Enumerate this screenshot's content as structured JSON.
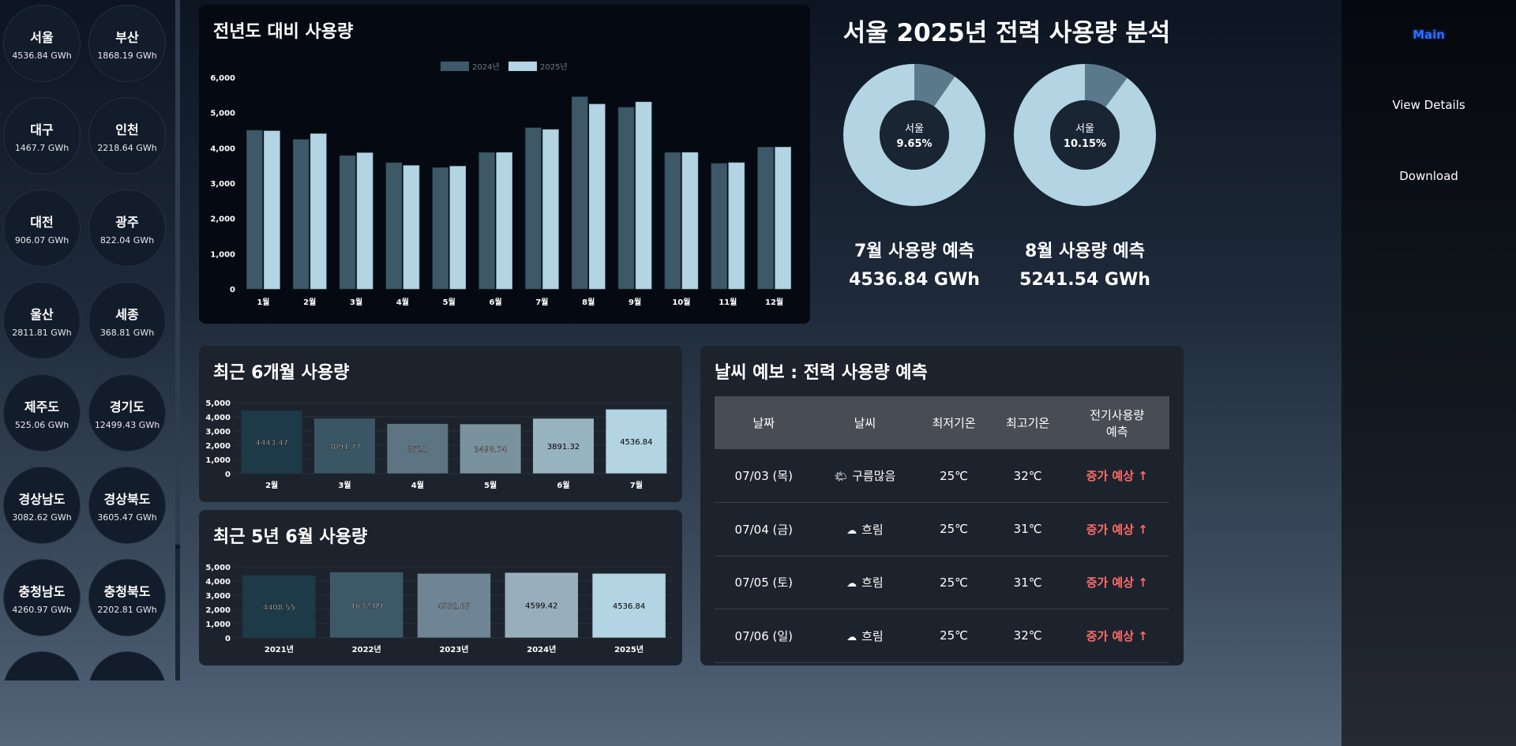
{
  "sidebar": {
    "regions": [
      {
        "name": "서울",
        "value": "4536.84 GWh"
      },
      {
        "name": "부산",
        "value": "1868.19 GWh"
      },
      {
        "name": "대구",
        "value": "1467.7 GWh"
      },
      {
        "name": "인천",
        "value": "2218.64 GWh"
      },
      {
        "name": "대전",
        "value": "906.07 GWh"
      },
      {
        "name": "광주",
        "value": "822.04 GWh"
      },
      {
        "name": "울산",
        "value": "2811.81 GWh"
      },
      {
        "name": "세종",
        "value": "368.81 GWh"
      },
      {
        "name": "제주도",
        "value": "525.06 GWh"
      },
      {
        "name": "경기도",
        "value": "12499.43 GWh"
      },
      {
        "name": "경상남도",
        "value": "3082.62 GWh"
      },
      {
        "name": "경상북도",
        "value": "3605.47 GWh"
      },
      {
        "name": "충청남도",
        "value": "4260.97 GWh"
      },
      {
        "name": "충청북도",
        "value": "2202.81 GWh"
      },
      {
        "name": "",
        "value": ""
      },
      {
        "name": "",
        "value": ""
      }
    ]
  },
  "yoy": {
    "title": "전년도 대비 사용량"
  },
  "analysis": {
    "title": "서울 2025년 전력 사용량 분석",
    "july": {
      "center_name": "서울",
      "center_pct": "9.65%",
      "label": "7월 사용량 예측",
      "value": "4536.84 GWh",
      "share": 0.0965
    },
    "august": {
      "center_name": "서울",
      "center_pct": "10.15%",
      "label": "8월 사용량 예측",
      "value": "5241.54 GWh",
      "share": 0.1015
    }
  },
  "recent6": {
    "title": "최근 6개월 사용량"
  },
  "five_year": {
    "title": "최근 5년 6월 사용량"
  },
  "weather": {
    "title": "날씨 예보 : 전력 사용량 예측",
    "headers": [
      "날짜",
      "날씨",
      "최저기온",
      "최고기온",
      "전기사용량\n예측"
    ],
    "rows": [
      {
        "date": "07/03 (목)",
        "icon": "🌤",
        "weather": "구름많음",
        "low": "25℃",
        "high": "32℃",
        "forecast": "증가 예상 ↑"
      },
      {
        "date": "07/04 (금)",
        "icon": "☁",
        "weather": "흐림",
        "low": "25℃",
        "high": "31℃",
        "forecast": "증가 예상 ↑"
      },
      {
        "date": "07/05 (토)",
        "icon": "☁",
        "weather": "흐림",
        "low": "25℃",
        "high": "31℃",
        "forecast": "증가 예상 ↑"
      },
      {
        "date": "07/06 (일)",
        "icon": "☁",
        "weather": "흐림",
        "low": "25℃",
        "high": "32℃",
        "forecast": "증가 예상 ↑"
      }
    ]
  },
  "nav": {
    "main": "Main",
    "details": "View Details",
    "download": "Download"
  },
  "colors": {
    "dark_bar": "#3d5968",
    "light_bar": "#b3d4e2",
    "donut_light": "#b3d4e2",
    "donut_dark": "#5a7a8b",
    "increase": "#ff6b6b"
  },
  "chart_data": [
    {
      "type": "bar",
      "title": "전년도 대비 사용량",
      "categories": [
        "1월",
        "2월",
        "3월",
        "4월",
        "5월",
        "6월",
        "7월",
        "8월",
        "9월",
        "10월",
        "11월",
        "12월"
      ],
      "series": [
        {
          "name": "2024년",
          "values": [
            4500,
            4240,
            3780,
            3580,
            3440,
            3870,
            4570,
            5450,
            5150,
            3870,
            3560,
            4020
          ]
        },
        {
          "name": "2025년",
          "values": [
            4480,
            4400,
            3860,
            3500,
            3480,
            3870,
            4520,
            5240,
            5300,
            3870,
            3580,
            4020
          ]
        }
      ],
      "yticks": [
        "0",
        "1,000",
        "2,000",
        "3,000",
        "4,000",
        "5,000",
        "6,000"
      ],
      "ylim": [
        0,
        6000
      ],
      "legend": "top-center"
    },
    {
      "type": "bar",
      "title": "최근 6개월 사용량",
      "categories": [
        "2월",
        "3월",
        "4월",
        "5월",
        "6월",
        "7월"
      ],
      "values": [
        4443.47,
        3891.77,
        3521,
        3498.74,
        3891.32,
        4536.84
      ],
      "labels": [
        "4443.47",
        "3891.77",
        "3521",
        "3498.74",
        "3891.32",
        "4536.84"
      ],
      "colors": [
        "#1e3a48",
        "#3a5563",
        "#5d7482",
        "#7a919e",
        "#98b3c0",
        "#b3d4e2"
      ],
      "yticks": [
        "0",
        "1,000",
        "2,000",
        "3,000",
        "4,000",
        "5,000"
      ],
      "ylim": [
        0,
        5000
      ]
    },
    {
      "type": "bar",
      "title": "최근 5년 6월 사용량",
      "categories": [
        "2021년",
        "2022년",
        "2023년",
        "2024년",
        "2025년"
      ],
      "values": [
        4408.55,
        4632.09,
        4532.65,
        4599.42,
        4536.84
      ],
      "labels": [
        "4408.55",
        "4632.09",
        "4532.65",
        "4599.42",
        "4536.84"
      ],
      "colors": [
        "#1e3a48",
        "#3d5968",
        "#6f8596",
        "#98aebd",
        "#b3d4e2"
      ],
      "yticks": [
        "0",
        "1,000",
        "2,000",
        "3,000",
        "4,000",
        "5,000"
      ],
      "ylim": [
        0,
        5000
      ]
    }
  ]
}
